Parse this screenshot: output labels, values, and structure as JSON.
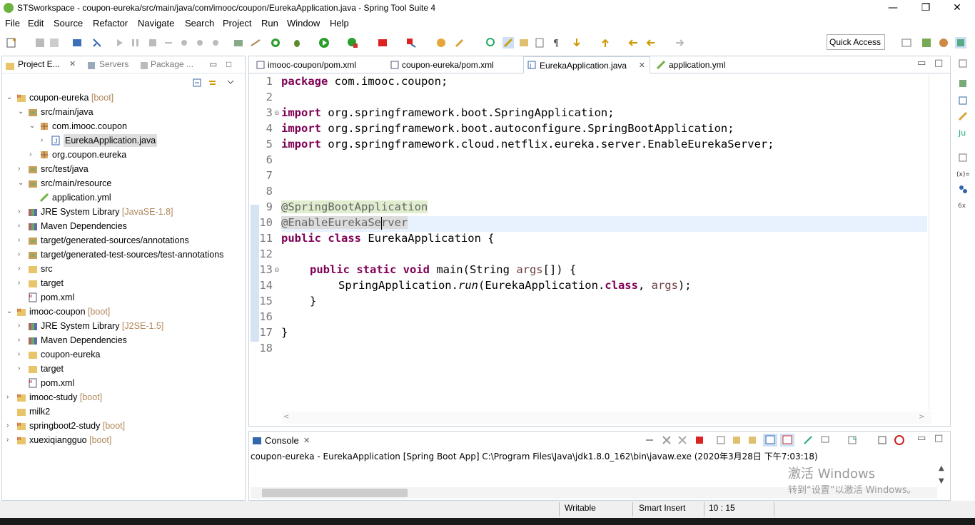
{
  "window": {
    "title": "STSworkspace - coupon-eureka/src/main/java/com/imooc/coupon/EurekaApplication.java - Spring Tool Suite 4",
    "minimize": "—",
    "restore": "❐",
    "close": "✕"
  },
  "menu": [
    "File",
    "Edit",
    "Source",
    "Refactor",
    "Navigate",
    "Search",
    "Project",
    "Run",
    "Window",
    "Help"
  ],
  "quick_access": "Quick Access",
  "left_tabs": [
    "Project E...",
    "Servers",
    "Package ..."
  ],
  "tree": [
    {
      "label": "coupon-eureka",
      "suffix": "[boot]",
      "indent": 0,
      "exp": "v",
      "icon": "maven-project-icon"
    },
    {
      "label": "src/main/java",
      "suffix": "",
      "indent": 1,
      "exp": "v",
      "icon": "source-folder-icon"
    },
    {
      "label": "com.imooc.coupon",
      "suffix": "",
      "indent": 2,
      "exp": "v",
      "icon": "package-icon"
    },
    {
      "label": "EurekaApplication.java",
      "suffix": "",
      "indent": 3,
      "exp": ">",
      "icon": "java-file-icon",
      "selected": true
    },
    {
      "label": "org.coupon.eureka",
      "suffix": "",
      "indent": 2,
      "exp": ">",
      "icon": "package-icon"
    },
    {
      "label": "src/test/java",
      "suffix": "",
      "indent": 1,
      "exp": ">",
      "icon": "source-folder-icon"
    },
    {
      "label": "src/main/resource",
      "suffix": "",
      "indent": 1,
      "exp": "v",
      "icon": "source-folder-icon"
    },
    {
      "label": "application.yml",
      "suffix": "",
      "indent": 2,
      "exp": "",
      "icon": "yml-file-icon"
    },
    {
      "label": "JRE System Library",
      "suffix": "[JavaSE-1.8]",
      "indent": 1,
      "exp": ">",
      "icon": "library-icon"
    },
    {
      "label": "Maven Dependencies",
      "suffix": "",
      "indent": 1,
      "exp": ">",
      "icon": "library-icon"
    },
    {
      "label": "target/generated-sources/annotations",
      "suffix": "",
      "indent": 1,
      "exp": ">",
      "icon": "source-folder-icon"
    },
    {
      "label": "target/generated-test-sources/test-annotations",
      "suffix": "",
      "indent": 1,
      "exp": ">",
      "icon": "source-folder-icon"
    },
    {
      "label": "src",
      "suffix": "",
      "indent": 1,
      "exp": ">",
      "icon": "folder-icon"
    },
    {
      "label": "target",
      "suffix": "",
      "indent": 1,
      "exp": ">",
      "icon": "folder-icon"
    },
    {
      "label": "pom.xml",
      "suffix": "",
      "indent": 1,
      "exp": "",
      "icon": "xml-file-icon"
    },
    {
      "label": "imooc-coupon",
      "suffix": "[boot]",
      "indent": 0,
      "exp": "v",
      "icon": "maven-project-icon"
    },
    {
      "label": "JRE System Library",
      "suffix": "[J2SE-1.5]",
      "indent": 1,
      "exp": ">",
      "icon": "library-icon"
    },
    {
      "label": "Maven Dependencies",
      "suffix": "",
      "indent": 1,
      "exp": ">",
      "icon": "library-icon"
    },
    {
      "label": "coupon-eureka",
      "suffix": "",
      "indent": 1,
      "exp": ">",
      "icon": "folder-icon"
    },
    {
      "label": "target",
      "suffix": "",
      "indent": 1,
      "exp": ">",
      "icon": "folder-icon"
    },
    {
      "label": "pom.xml",
      "suffix": "",
      "indent": 1,
      "exp": "",
      "icon": "xml-file-icon"
    },
    {
      "label": "imooc-study",
      "suffix": "[boot]",
      "indent": 0,
      "exp": ">",
      "icon": "maven-project-icon"
    },
    {
      "label": "milk2",
      "suffix": "",
      "indent": 0,
      "exp": "",
      "icon": "folder-icon"
    },
    {
      "label": "springboot2-study",
      "suffix": "[boot]",
      "indent": 0,
      "exp": ">",
      "icon": "maven-project-icon"
    },
    {
      "label": "xuexiqiangguo",
      "suffix": "[boot]",
      "indent": 0,
      "exp": ">",
      "icon": "maven-project-icon"
    }
  ],
  "editor_tabs": [
    "imooc-coupon/pom.xml",
    "coupon-eureka/pom.xml",
    "EurekaApplication.java",
    "application.yml"
  ],
  "line_numbers": [
    "1",
    "2",
    "3",
    "4",
    "5",
    "6",
    "7",
    "8",
    "9",
    "10",
    "11",
    "12",
    "13",
    "14",
    "15",
    "16",
    "17",
    "18"
  ],
  "code": {
    "l1_kw": "package",
    "l1": " com.imooc.coupon;",
    "l3_kw": "import",
    "l3": " org.springframework.boot.SpringApplication;",
    "l4_kw": "import",
    "l4": " org.springframework.boot.autoconfigure.SpringBootApplication;",
    "l5_kw": "import",
    "l5": " org.springframework.cloud.netflix.eureka.server.EnableEurekaServer;",
    "l9": "@SpringBootApplication",
    "l10": "@EnableEurekaServer",
    "l11_kw": "public class",
    "l11": " EurekaApplication {",
    "l13_kw": "public static void",
    "l13a": " main(String ",
    "l13b": "args",
    "l13c": "[]) {",
    "l14a": "SpringApplication.",
    "l14b": "run",
    "l14c": "(EurekaApplication.",
    "l14d": "class",
    "l14e": ", ",
    "l14f": "args",
    "l14g": ");",
    "l15": "}",
    "l17": "}"
  },
  "console": {
    "tab": "Console",
    "text": "coupon-eureka - EurekaApplication [Spring Boot App] C:\\Program Files\\Java\\jdk1.8.0_162\\bin\\javaw.exe (2020年3月28日 下午7:03:18)"
  },
  "status": {
    "writable": "Writable",
    "insert": "Smart Insert",
    "pos": "10 : 15"
  },
  "watermark": {
    "line1": "激活 Windows",
    "line2": "转到“设置”以激活 Windows。"
  }
}
